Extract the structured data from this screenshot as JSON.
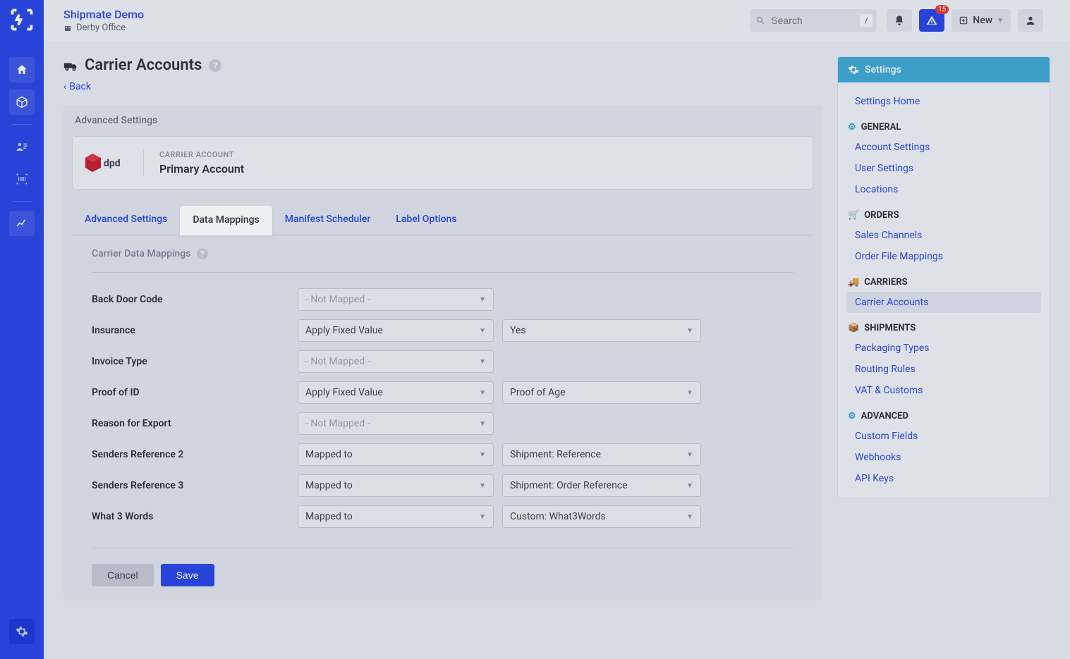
{
  "app": {
    "title": "Shipmate Demo",
    "location": "Derby Office"
  },
  "search": {
    "placeholder": "Search",
    "kbd": "/"
  },
  "alert_badge": "15",
  "new_button": "New",
  "page": {
    "title": "Carrier Accounts",
    "back": "Back"
  },
  "panel_title": "Advanced Settings",
  "carrier": {
    "logo_text": "dpd",
    "label": "CARRIER ACCOUNT",
    "name": "Primary Account"
  },
  "tabs": {
    "adv": "Advanced Settings",
    "data": "Data Mappings",
    "manifest": "Manifest Scheduler",
    "label": "Label Options"
  },
  "section": "Carrier Data Mappings",
  "opts": {
    "not_mapped": "- Not Mapped -",
    "apply_fixed": "Apply Fixed Value",
    "mapped_to": "Mapped to"
  },
  "fields": {
    "back_door": {
      "label": "Back Door Code"
    },
    "insurance": {
      "label": "Insurance",
      "val2": "Yes"
    },
    "invoice": {
      "label": "Invoice Type"
    },
    "proof": {
      "label": "Proof of ID",
      "val2": "Proof of Age"
    },
    "reason": {
      "label": "Reason for Export"
    },
    "sref2": {
      "label": "Senders Reference 2",
      "val2": "Shipment: Reference"
    },
    "sref3": {
      "label": "Senders Reference 3",
      "val2": "Shipment: Order Reference"
    },
    "w3w": {
      "label": "What 3 Words",
      "val2": "Custom: What3Words"
    }
  },
  "buttons": {
    "cancel": "Cancel",
    "save": "Save"
  },
  "settings_panel": {
    "title": "Settings",
    "home": "Settings Home",
    "groups": {
      "general": {
        "title": "GENERAL",
        "items": {
          "account": "Account Settings",
          "user": "User Settings",
          "locations": "Locations"
        }
      },
      "orders": {
        "title": "ORDERS",
        "items": {
          "channels": "Sales Channels",
          "ofm": "Order File Mappings"
        }
      },
      "carriers": {
        "title": "CARRIERS",
        "items": {
          "ca": "Carrier Accounts"
        }
      },
      "shipments": {
        "title": "SHIPMENTS",
        "items": {
          "pt": "Packaging Types",
          "rr": "Routing Rules",
          "vat": "VAT & Customs"
        }
      },
      "advanced": {
        "title": "ADVANCED",
        "items": {
          "cf": "Custom Fields",
          "wh": "Webhooks",
          "ak": "API Keys"
        }
      }
    }
  }
}
